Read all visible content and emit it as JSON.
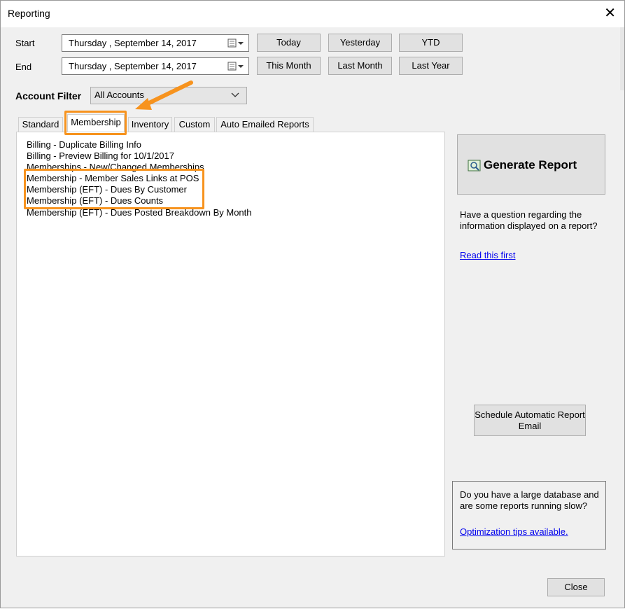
{
  "window": {
    "title": "Reporting",
    "close_glyph": "✕"
  },
  "dates": {
    "start_label": "Start",
    "end_label": "End",
    "start_value": "Thursday  , September 14, 2017",
    "end_value": "Thursday  , September 14, 2017"
  },
  "quick_buttons": {
    "today": "Today",
    "yesterday": "Yesterday",
    "ytd": "YTD",
    "this_month": "This Month",
    "last_month": "Last Month",
    "last_year": "Last Year"
  },
  "account_filter": {
    "label": "Account Filter",
    "value": "All Accounts"
  },
  "tabs": [
    {
      "label": "Standard"
    },
    {
      "label": "Membership"
    },
    {
      "label": "Inventory"
    },
    {
      "label": "Custom"
    },
    {
      "label": "Auto Emailed Reports"
    }
  ],
  "reports": [
    "Billing - Duplicate Billing Info",
    "Billing - Preview Billing for 10/1/2017",
    "Memberships - New/Changed Memberships",
    "Membership - Member Sales Links at POS",
    "Membership (EFT) - Dues By Customer",
    "Membership (EFT) - Dues Counts",
    "Membership (EFT) - Dues Posted Breakdown By Month"
  ],
  "side": {
    "generate_label": "Generate Report",
    "question_text": "Have a question regarding the information displayed on a report?",
    "read_first_link": "Read this first",
    "schedule_label": "Schedule Automatic Report Email",
    "optimization_text": "Do you have a large database and are some reports running slow?",
    "optimization_link": "Optimization tips available.",
    "close_label": "Close"
  },
  "colors": {
    "highlight": "#f7931e",
    "link": "#0000ee"
  }
}
